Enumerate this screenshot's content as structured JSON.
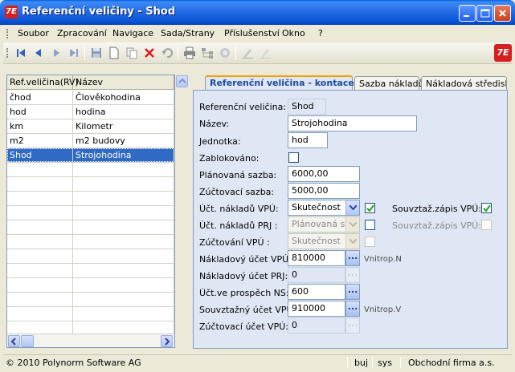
{
  "window": {
    "title": "Referenční veličiny - Shod",
    "logo_text": "7E"
  },
  "menu": [
    "Soubor",
    "Zpracování",
    "Navigace",
    "Sada/Strany",
    "Příslušenství",
    "Okno",
    "?"
  ],
  "toolbar_icons": [
    "first-record-icon",
    "previous-record-icon",
    "next-record-icon",
    "last-record-icon",
    "save-icon",
    "new-document-icon",
    "copy-icon",
    "delete-icon",
    "undo-icon",
    "print-icon",
    "tree-icon",
    "disabled-icon",
    "edit-icon",
    "edit-disabled-icon"
  ],
  "grid": {
    "columns": [
      "Ref.veličina(RV)",
      "Název"
    ],
    "rows": [
      [
        "čhod",
        "Člověkohodina"
      ],
      [
        "hod",
        "hodina"
      ],
      [
        "km",
        "Kilometr"
      ],
      [
        "m2",
        "m2 budovy"
      ],
      [
        "Shod",
        "Strojohodina"
      ]
    ],
    "selected_index": 4
  },
  "tabs": [
    "Referenční veličina - kontace",
    "Sazba nákladů",
    "Nákladová středisk"
  ],
  "form": {
    "ref_velicina_label": "Referenční veličina:",
    "ref_velicina_value": "Shod",
    "nazev_label": "Název:",
    "nazev_value": "Strojohodina",
    "jednotka_label": "Jednotka:",
    "jednotka_value": "hod",
    "zablokovano_label": "Zablokováno:",
    "planovana_label": "Plánovaná sazba:",
    "planovana_value": "6000,00",
    "zuctovaci_sazba_label": "Zúčtovací sazba:",
    "zuctovaci_sazba_value": "5000,00",
    "uct_nakladu_vpu_label": "Účt. nákladů VPÚ:",
    "uct_nakladu_vpu_value": "Skutečnost",
    "souvtaz_zapis_vpu_label": "Souvztaž.zápis VPÚ:",
    "uct_nakladu_prj_label": "Účt. nákladů PRJ :",
    "uct_nakladu_prj_value": "Plánovaná sazba",
    "souvtaz_zapis_vpu2_label": "Souvztaž.zápis VPÚ:",
    "zuctovani_vpu_label": "Zúčtování VPÚ  :",
    "zuctovani_vpu_value": "Skutečnost",
    "nakladovy_ucet_vpu_label": "Nákladový účet VPÚ:",
    "nakladovy_ucet_vpu_value": "810000",
    "nakladovy_ucet_vpu_note": "Vnitrop.N",
    "nakladovy_ucet_prj_label": "Nákladový účet PRJ:",
    "nakladovy_ucet_prj_value": "0",
    "uct_ve_prospech_label": "Účt.ve prospěch NS:",
    "uct_ve_prospech_value": "600",
    "souvtazny_ucet_vpu_label": "Souvztažný účet VPÚ:",
    "souvtazny_ucet_vpu_value": "910000",
    "souvtazny_ucet_vpu_note": "Vnitrop.V",
    "zuctovaci_ucet_vpu_label": "Zúčtovací účet VPÚ:",
    "zuctovaci_ucet_vpu_value": "0"
  },
  "status": {
    "copyright": "© 2010 Polynorm Software AG",
    "user": "buj",
    "db": "sys",
    "company": "Obchodní firma a.s."
  },
  "colors": {
    "titlebar": "#0553d4",
    "selection": "#316ac5",
    "panel": "#dfe7f5",
    "tab_accent": "#f0a000"
  }
}
